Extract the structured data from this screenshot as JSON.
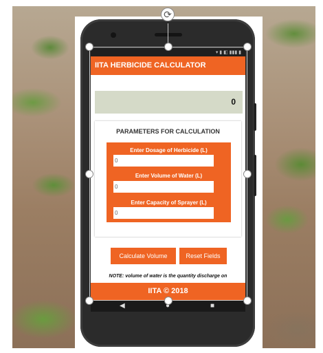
{
  "app": {
    "title": "IITA HERBICIDE CALCULATOR",
    "result_value": "0",
    "parameters_heading": "PARAMETERS FOR CALCULATION",
    "fields": [
      {
        "label": "Enter Dosage of Herbicide (L)",
        "value": "0"
      },
      {
        "label": "Enter Volume of Water (L)",
        "value": "0"
      },
      {
        "label": "Enter Capacity of Sprayer (L)",
        "value": "0"
      }
    ],
    "buttons": {
      "calculate": "Calculate Volume",
      "reset": "Reset Fields"
    },
    "note": "NOTE: volume of water is the quantity discharge on",
    "footer": "IITA © 2018"
  },
  "navbar": {
    "back": "◀",
    "home": "●",
    "recents": "■"
  },
  "overlay": {
    "rotate_icon": "⟳"
  },
  "colors": {
    "accent": "#ef6423",
    "result_bg": "#d5dac8"
  }
}
